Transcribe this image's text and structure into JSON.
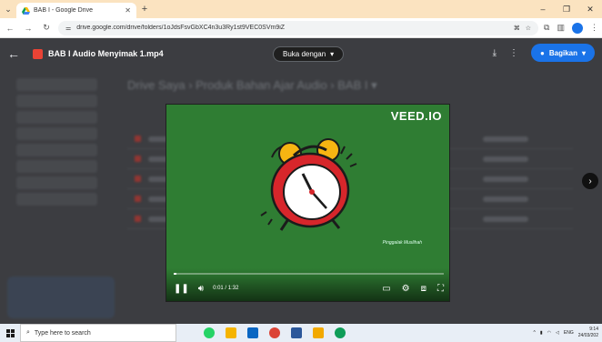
{
  "browser": {
    "tab_title": "BAB I - Google Drive",
    "url": "drive.google.com/drive/folders/1oJdsFsvGbXC4n3u3Ry1st9VEC0SVm9iZ",
    "icons": {
      "tab_search": "chevron-down-icon",
      "tab_close": "close-icon",
      "new_tab": "plus-icon",
      "back": "arrow-left-icon",
      "forward": "arrow-right-icon",
      "reload": "reload-icon",
      "site_info": "tune-icon",
      "translate": "translate-icon",
      "bookmark": "star-icon",
      "extensions": "puzzle-icon",
      "sidepanel": "sidepanel-icon",
      "menu": "more-vert-icon"
    }
  },
  "viewer": {
    "file_title": "BAB I Audio Menyimak 1.mp4",
    "open_with_label": "Buka dengan",
    "share_label": "Bagikan",
    "breadcrumb": "Drive Saya  ›  Produk Bahan Ajar Audio  ›  BAB I ▾"
  },
  "player": {
    "brand": "VEED.IO",
    "watermark": "Pinggalak Muslihah",
    "current_time": "0:01 / 1:32",
    "progress": 0.011
  },
  "taskbar": {
    "search_placeholder": "Type here to search",
    "language": "ENG",
    "time": "9:14",
    "date": "24/03/202"
  },
  "colors": {
    "share_button": "#1a73e8",
    "video_background": "#2f7d33",
    "tab_strip": "#fbe3c0",
    "file_icon": "#ea4335"
  }
}
